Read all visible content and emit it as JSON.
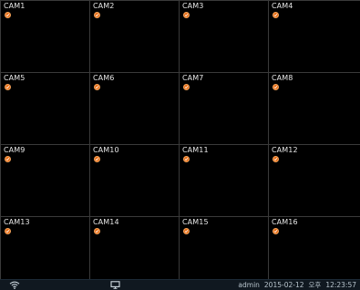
{
  "cameras": [
    {
      "label": "CAM1"
    },
    {
      "label": "CAM2"
    },
    {
      "label": "CAM3"
    },
    {
      "label": "CAM4"
    },
    {
      "label": "CAM5"
    },
    {
      "label": "CAM6"
    },
    {
      "label": "CAM7"
    },
    {
      "label": "CAM8"
    },
    {
      "label": "CAM9"
    },
    {
      "label": "CAM10"
    },
    {
      "label": "CAM11"
    },
    {
      "label": "CAM12"
    },
    {
      "label": "CAM13"
    },
    {
      "label": "CAM14"
    },
    {
      "label": "CAM15"
    },
    {
      "label": "CAM16"
    }
  ],
  "camera_status_icon": "record-status-icon",
  "colors": {
    "background": "#000000",
    "grid_line": "#3a3a3a",
    "status_icon": "#e8701a",
    "statusbar": "#101820"
  },
  "statusbar": {
    "left_icon": "wifi-icon",
    "center_icon": "monitor-icon",
    "user": "admin",
    "date": "2015-02-12",
    "ampm": "오후",
    "time": "12:23:57"
  }
}
